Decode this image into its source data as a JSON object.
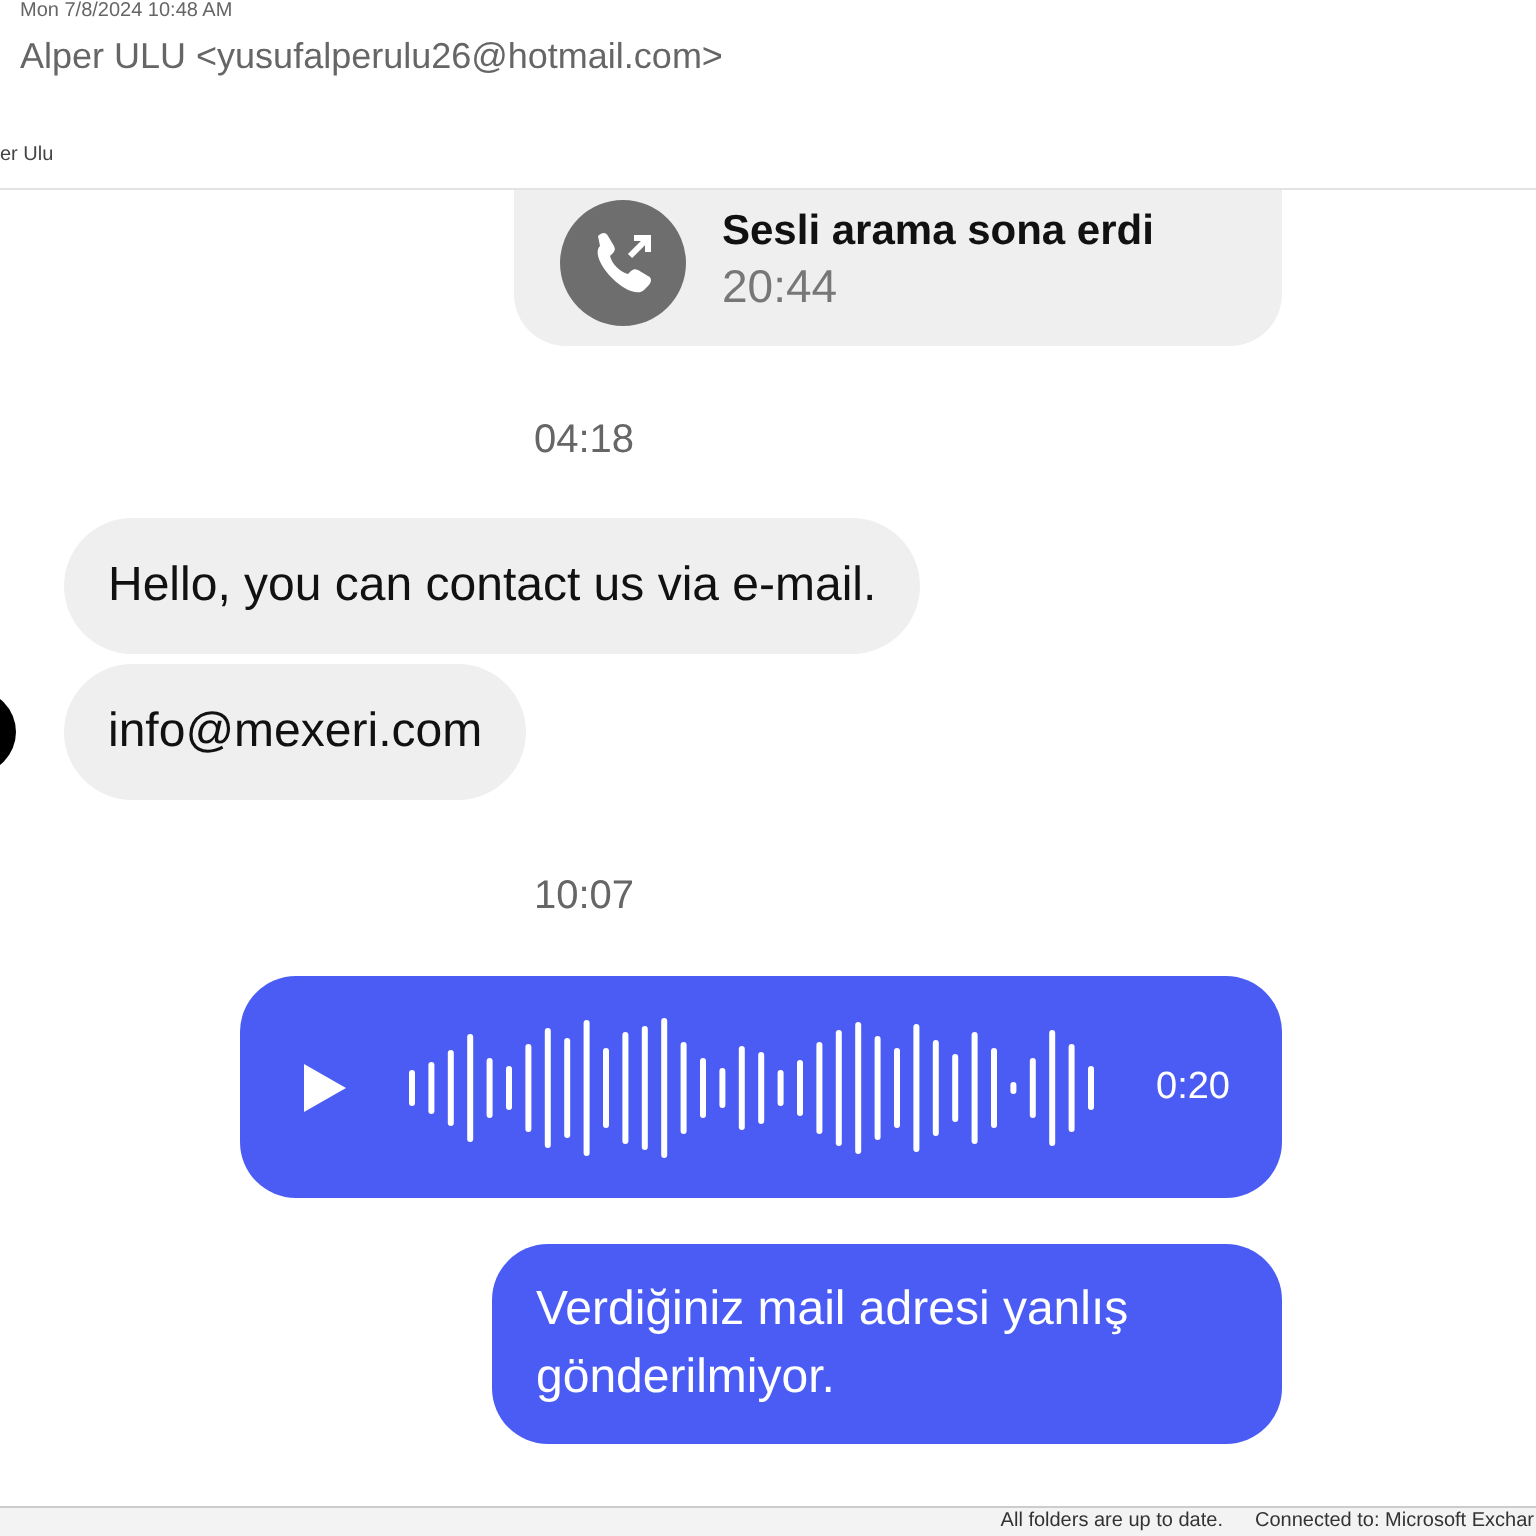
{
  "email": {
    "date": "Mon 7/8/2024 10:48 AM",
    "sender": "Alper ULU <yusufalperulu26@hotmail.com>",
    "recipient": "er Ulu"
  },
  "chat": {
    "messages": [
      {
        "kind": "call",
        "title": "Sesli arama sona erdi",
        "time": "20:44"
      },
      {
        "kind": "time",
        "text": "04:18"
      },
      {
        "kind": "text",
        "text": "Hello, you can contact us via e-mail.",
        "outgoing": false,
        "avatar": false
      },
      {
        "kind": "text",
        "text": "info@mexeri.com",
        "outgoing": false,
        "avatar": true
      },
      {
        "kind": "time",
        "text": "10:07"
      },
      {
        "kind": "voice",
        "duration": "0:20"
      },
      {
        "kind": "text",
        "text": "Verdiğiniz mail adresi yanlış gönderilmiyor.",
        "outgoing": true
      }
    ]
  },
  "status_bar": [
    "All folders are up to date.",
    "Connected to: Microsoft Exchar"
  ]
}
